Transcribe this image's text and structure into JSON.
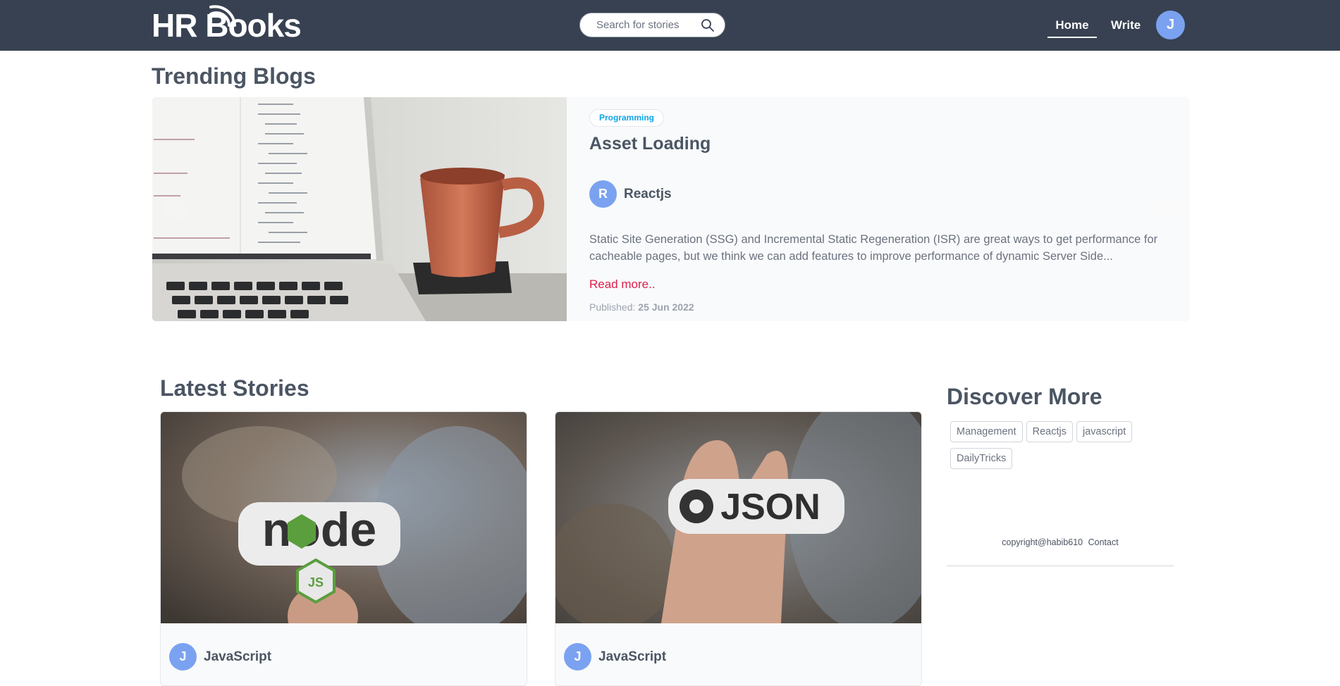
{
  "nav": {
    "logo": "HR Books",
    "search_placeholder": "Search for stories",
    "home": "Home",
    "write": "Write",
    "avatar_initial": "J"
  },
  "trending": {
    "title": "Trending Blogs",
    "slide": {
      "category": "Programming",
      "title": "Asset Loading",
      "author_initial": "R",
      "author": "Reactjs",
      "excerpt": "Static Site Generation (SSG) and Incremental Static Regeneration (ISR) are great ways to get performance for cacheable pages, but we think we can add features to improve performance of dynamic Server Side...",
      "read_more": "Read more..",
      "published_label": "Published:",
      "published_date": "25 Jun 2022"
    }
  },
  "latest": {
    "title": "Latest Stories",
    "cards": [
      {
        "author_initial": "J",
        "author": "JavaScript"
      },
      {
        "author_initial": "J",
        "author": "JavaScript"
      }
    ]
  },
  "discover": {
    "title": "Discover More",
    "tags": [
      "Management",
      "Reactjs",
      "javascript",
      "DailyTricks"
    ]
  },
  "footer": {
    "copyright": "copyright@habib610",
    "contact": "Contact"
  },
  "colors": {
    "navbar": "#374151",
    "accent_avatar": "#7aa2f0",
    "read_more": "#e11d48",
    "badge_text": "#0ea5e9"
  }
}
